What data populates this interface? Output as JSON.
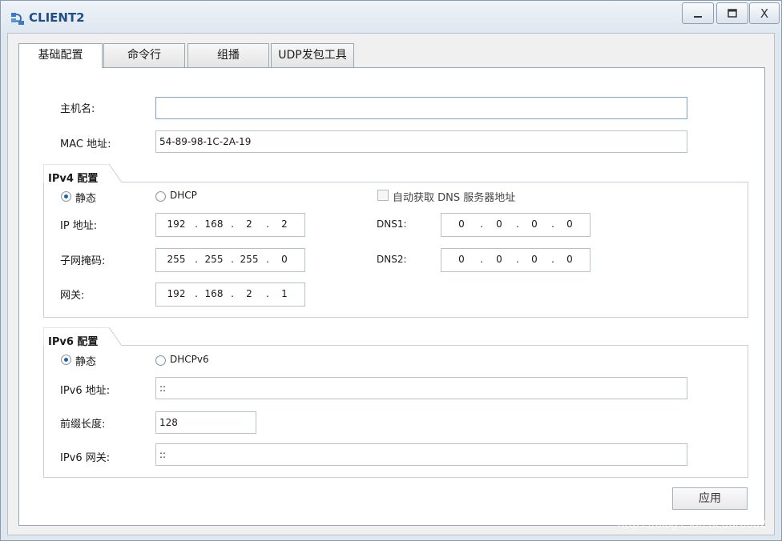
{
  "window": {
    "title": "CLIENT2",
    "close_label": "X"
  },
  "tabs": [
    {
      "label": "基础配置",
      "active": true
    },
    {
      "label": "命令行",
      "active": false
    },
    {
      "label": "组播",
      "active": false
    },
    {
      "label": "UDP发包工具",
      "active": false
    }
  ],
  "basic": {
    "hostname_label": "主机名:",
    "hostname_value": "",
    "mac_label": "MAC 地址:",
    "mac_value": "54-89-98-1C-2A-19"
  },
  "ipv4": {
    "group_title": "IPv4 配置",
    "static_label": "静态",
    "dhcp_label": "DHCP",
    "dns_auto_label": "自动获取 DNS 服务器地址",
    "ip_label": "IP 地址:",
    "ip": [
      "192",
      "168",
      "2",
      "2"
    ],
    "mask_label": "子网掩码:",
    "mask": [
      "255",
      "255",
      "255",
      "0"
    ],
    "gateway_label": "网关:",
    "gateway": [
      "192",
      "168",
      "2",
      "1"
    ],
    "dns1_label": "DNS1:",
    "dns1": [
      "0",
      "0",
      "0",
      "0"
    ],
    "dns2_label": "DNS2:",
    "dns2": [
      "0",
      "0",
      "0",
      "0"
    ]
  },
  "ipv6": {
    "group_title": "IPv6 配置",
    "static_label": "静态",
    "dhcpv6_label": "DHCPv6",
    "address_label": "IPv6 地址:",
    "address_value": "::",
    "prefix_label": "前缀长度:",
    "prefix_value": "128",
    "gateway_label": "IPv6 网关:",
    "gateway_value": "::"
  },
  "apply_label": "应用",
  "watermark": "https://blog.csdn.net/ar0002",
  "colors": {
    "title_text": "#1f4f86",
    "accent_radio": "#1f5ea8"
  }
}
